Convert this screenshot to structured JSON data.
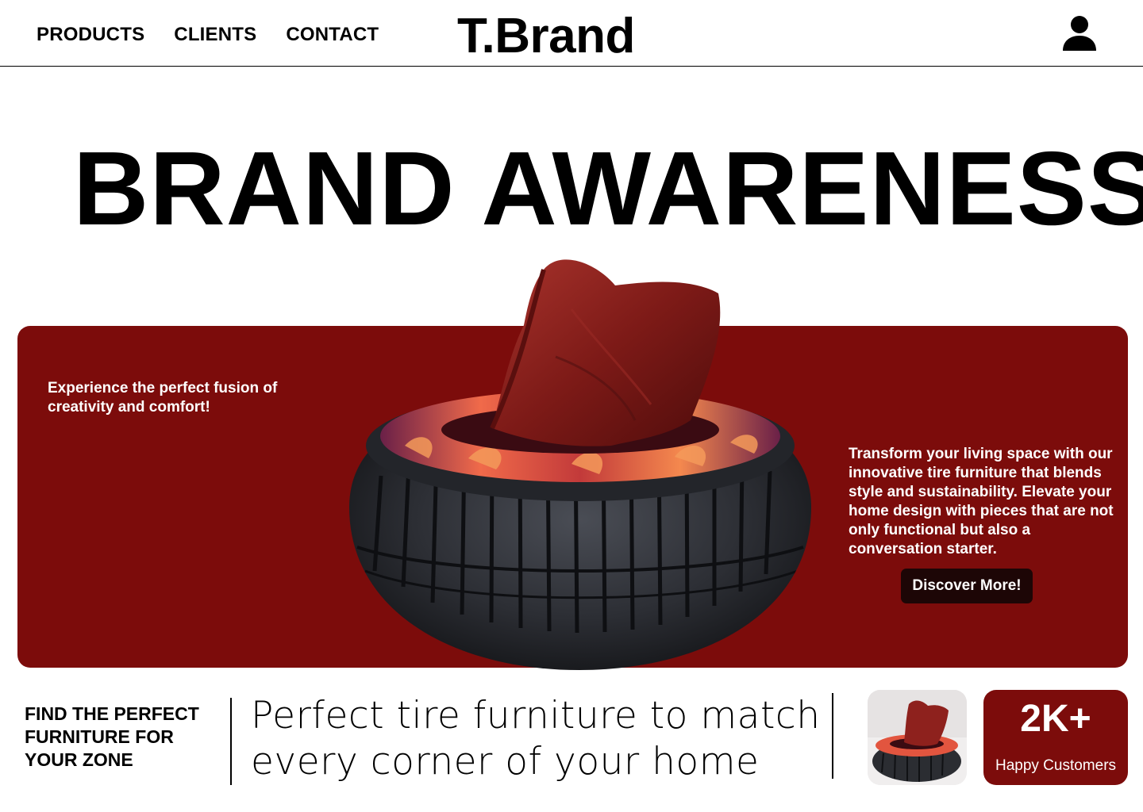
{
  "nav": {
    "items": [
      "PRODUCTS",
      "CLIENTS",
      "CONTACT"
    ],
    "brand": "T.Brand",
    "user_icon": "user-icon"
  },
  "hero": {
    "title": "BRAND AWARENESS"
  },
  "banner": {
    "tagline": "Experience the perfect fusion of creativity and comfort!",
    "description": "Transform your living space with our innovative tire furniture that blends style and sustainability. Elevate your home design with pieces that are not only functional but also a conversation starter.",
    "cta_label": "Discover More!",
    "product_image": "tire-chair-with-red-leather-pillow",
    "colors": {
      "banner": "#7c0c0b",
      "cta": "#1d0606",
      "text": "#ffffff"
    }
  },
  "bottom": {
    "heading": "FIND THE PERFECT FURNITURE FOR YOUR ZONE",
    "tagline": "Perfect tire furniture  to match every corner of your home",
    "thumbnail": "tire-chair-thumbnail",
    "stat": {
      "value": "2K+",
      "label": "Happy Customers"
    }
  }
}
